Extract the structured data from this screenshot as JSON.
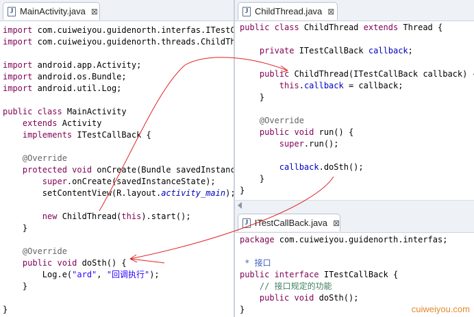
{
  "left_editor": {
    "tab": {
      "icon": "java-file-icon",
      "label": "MainActivity.java",
      "close": "⊠"
    },
    "lines": [
      "import com.cuiweiyou.guidenorth.interfas.ITestCa",
      "import com.cuiweiyou.guidenorth.threads.ChildThr",
      "",
      "import android.app.Activity;",
      "import android.os.Bundle;",
      "import android.util.Log;",
      "",
      "public class MainActivity",
      "    extends Activity",
      "    implements ITestCallBack {",
      "",
      "    @Override",
      "    protected void onCreate(Bundle savedInstance",
      "        super.onCreate(savedInstanceState);",
      "        setContentView(R.layout.activity_main);",
      "",
      "        new ChildThread(this).start();",
      "    }",
      "",
      "    @Override",
      "    public void doSth() {",
      "        Log.e(\"ard\", \"回调执行\");",
      "    }",
      "",
      "}"
    ]
  },
  "child_editor": {
    "tab": {
      "icon": "java-file-icon",
      "label": "ChildThread.java",
      "close": "⊠"
    },
    "lines": [
      "public class ChildThread extends Thread {",
      "",
      "    private ITestCallBack callback;",
      "",
      "    public ChildThread(ITestCallBack callback) {",
      "        this.callback = callback;",
      "    }",
      "",
      "    @Override",
      "    public void run() {",
      "        super.run();",
      "",
      "        callback.doSth();",
      "    }",
      "}"
    ]
  },
  "callback_editor": {
    "tab": {
      "icon": "java-file-icon",
      "label": "ITestCallBack.java",
      "close": "⊠"
    },
    "lines": [
      "package com.cuiweiyou.guidenorth.interfas;",
      "",
      " * 接口",
      "public interface ITestCallBack {",
      "    // 接口规定的功能",
      "    public void doSth();",
      "}"
    ]
  },
  "watermark": "cuiweiyou.com",
  "colors": {
    "keyword": "#7f0055",
    "string": "#2a00ff",
    "field": "#0000c0",
    "annotation": "#646464",
    "comment": "#3f7f5f",
    "arrow": "#e02020"
  }
}
